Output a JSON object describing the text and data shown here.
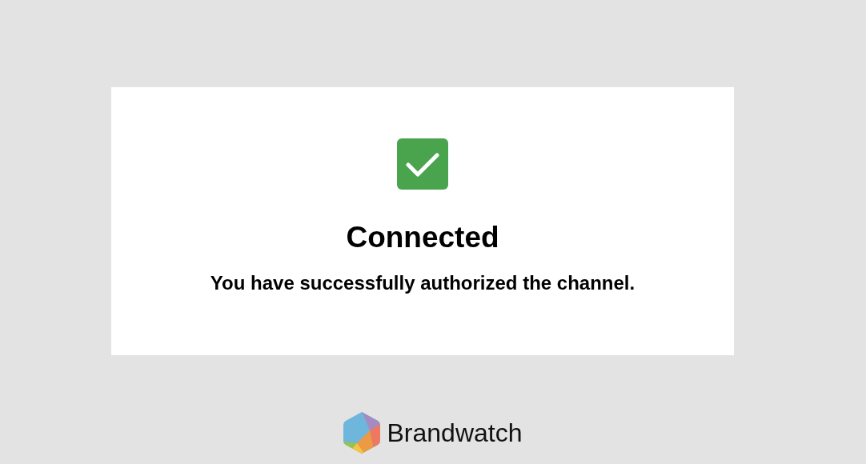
{
  "card": {
    "title": "Connected",
    "message": "You have successfully authorized the channel."
  },
  "footer": {
    "brand": "Brandwatch"
  }
}
